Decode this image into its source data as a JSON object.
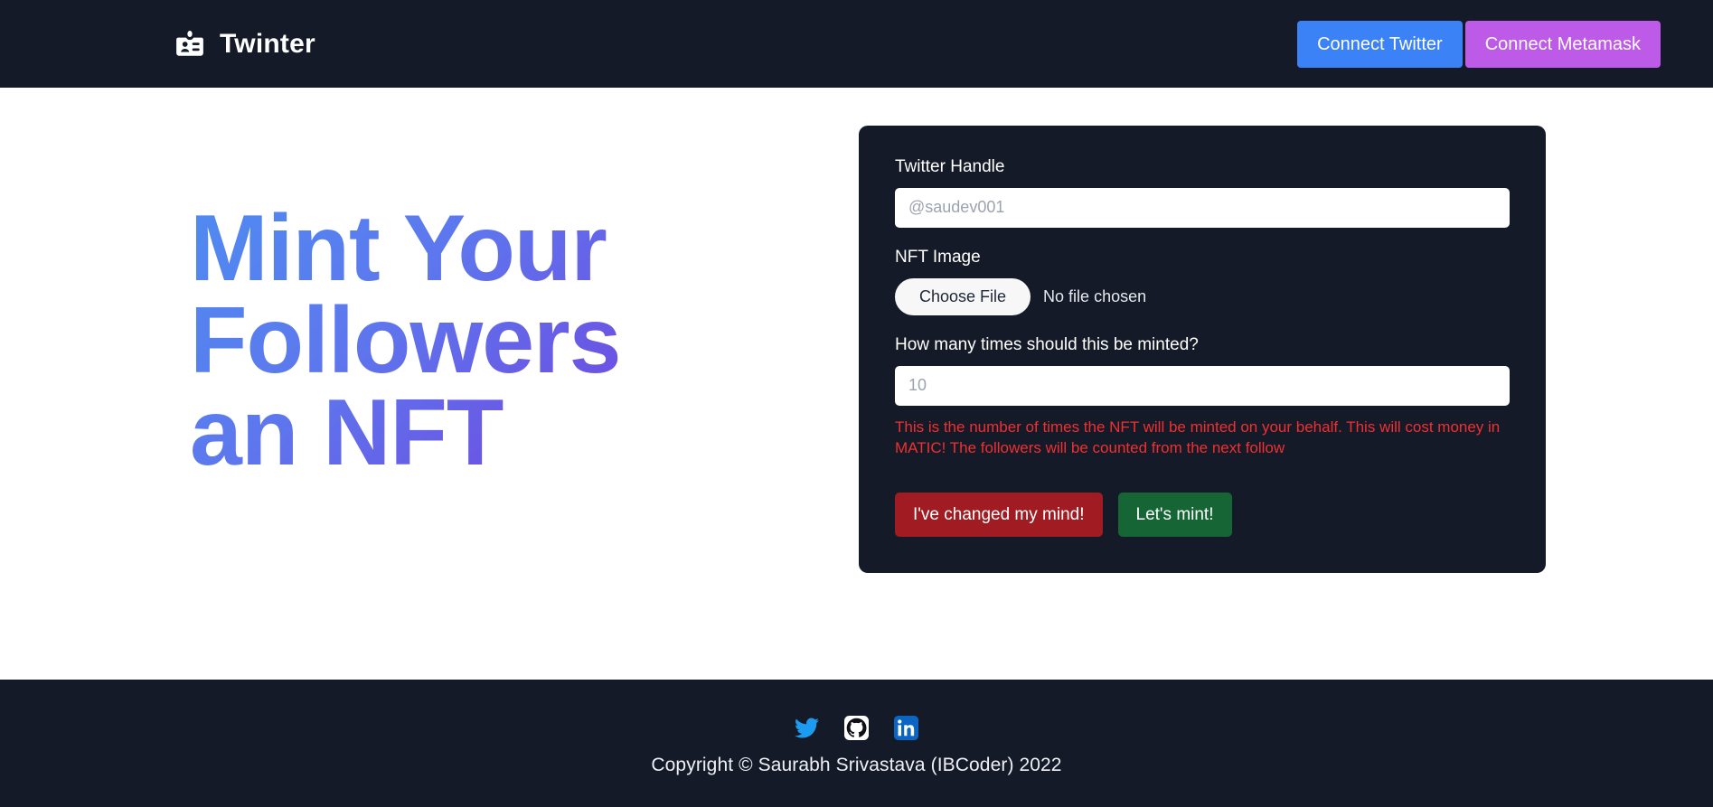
{
  "header": {
    "logo_icon": "id-badge-icon",
    "brand_name": "Twinter",
    "buttons": [
      {
        "label": "Connect Twitter",
        "color": "#3b82f6"
      },
      {
        "label": "Connect Metamask",
        "color": "#bd5ae8"
      }
    ]
  },
  "hero": {
    "title": "Mint Your Followers an NFT",
    "gradient_from": "#4f8bf0",
    "gradient_to": "#6b42de"
  },
  "form": {
    "handle": {
      "label": "Twitter Handle",
      "placeholder": "@saudev001",
      "value": ""
    },
    "nft_image": {
      "label": "NFT Image",
      "button_label": "Choose File",
      "status": "No file chosen"
    },
    "mint_count": {
      "label": "How many times should this be minted?",
      "placeholder": "10",
      "value": "",
      "helper": "This is the number of times the NFT will be minted on your behalf. This will cost money in MATIC! The followers will be counted from the next follow",
      "helper_color": "#f03030"
    },
    "actions": {
      "cancel_label": "I've changed my mind!",
      "cancel_color": "#a01c22",
      "mint_label": "Let's mint!",
      "mint_color": "#166534"
    }
  },
  "footer": {
    "socials": [
      {
        "name": "twitter-icon",
        "color": "#1d9bf0"
      },
      {
        "name": "github-icon",
        "color": "#ffffff"
      },
      {
        "name": "linkedin-icon",
        "color": "#0a66c2"
      }
    ],
    "copyright": "Copyright © Saurabh Srivastava (IBCoder) 2022"
  },
  "theme": {
    "surface_dark": "#141a28",
    "page_background": "#ffffff"
  }
}
